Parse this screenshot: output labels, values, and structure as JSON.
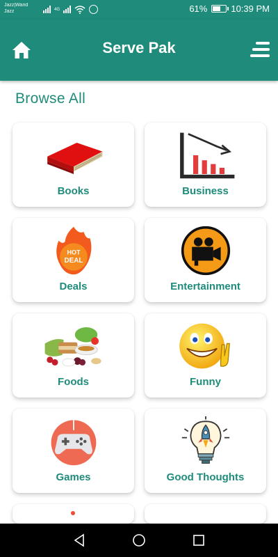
{
  "status_bar": {
    "carrier_line1": "Jazz|Warid",
    "carrier_line2": "Jazz",
    "network_type": "4G",
    "battery_percent": "61%",
    "battery_level": 0.61,
    "time": "10:39 PM"
  },
  "app_bar": {
    "title": "Serve Pak",
    "home_icon": "home-icon",
    "menu_icon": "menu-icon"
  },
  "content": {
    "section_title": "Browse All",
    "categories": [
      {
        "label": "Books",
        "icon": "book-icon"
      },
      {
        "label": "Business",
        "icon": "business-chart-icon"
      },
      {
        "label": "Deals",
        "icon": "hot-deal-icon"
      },
      {
        "label": "Entertainment",
        "icon": "movie-camera-icon"
      },
      {
        "label": "Foods",
        "icon": "food-icon"
      },
      {
        "label": "Funny",
        "icon": "smiley-icon"
      },
      {
        "label": "Games",
        "icon": "gamepad-icon"
      },
      {
        "label": "Good Thoughts",
        "icon": "lightbulb-rocket-icon"
      }
    ]
  },
  "colors": {
    "primary": "#1f8b7a",
    "card_background": "#ffffff",
    "nav_background": "#000000"
  },
  "nav_bar": {
    "back_icon": "back-icon",
    "home_icon": "home-circle-icon",
    "recents_icon": "recents-icon"
  }
}
